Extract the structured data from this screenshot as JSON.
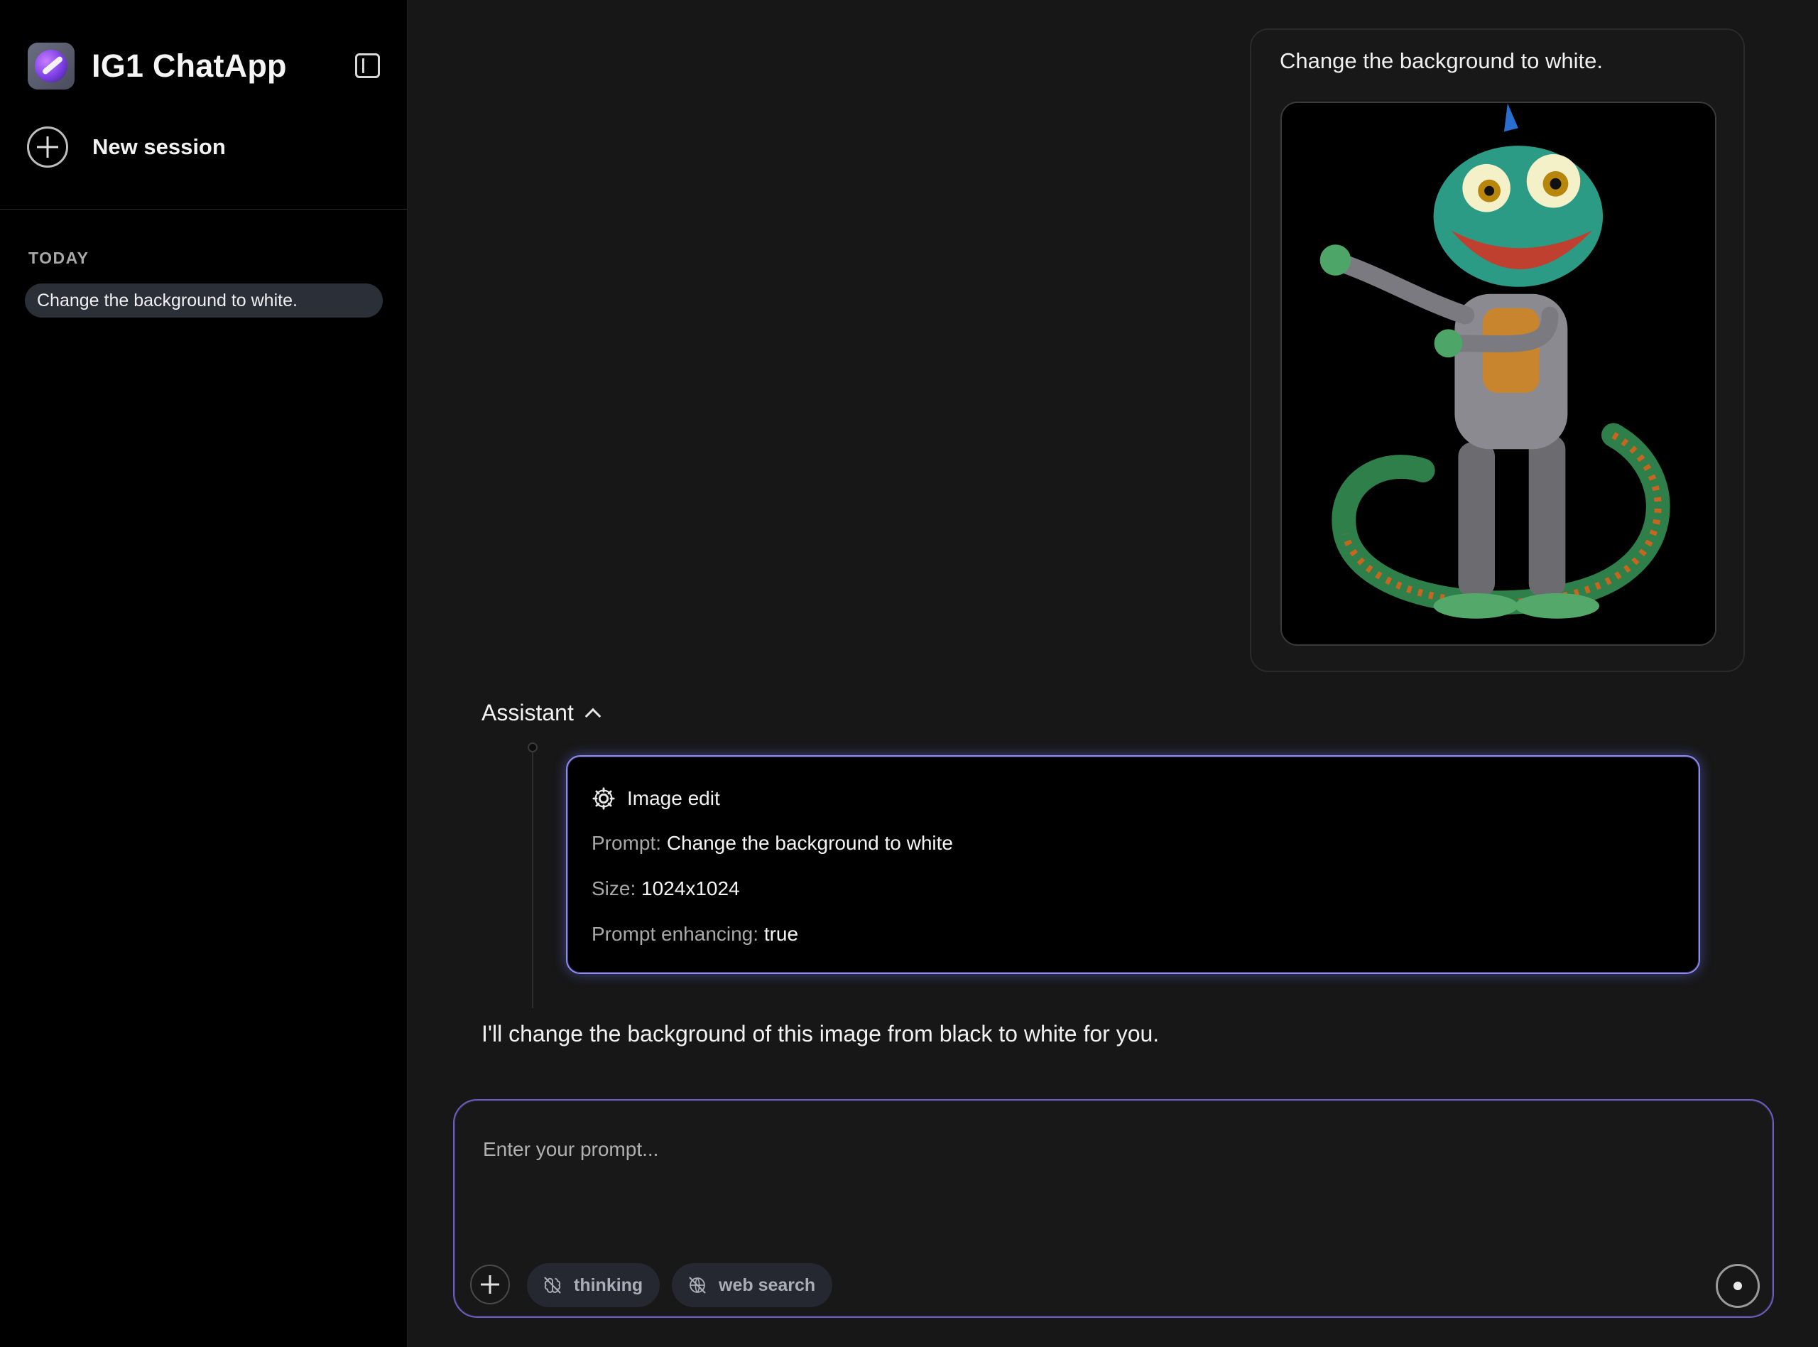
{
  "app": {
    "title": "IG1 ChatApp"
  },
  "sidebar": {
    "new_session_label": "New session",
    "sections": [
      {
        "label": "TODAY",
        "items": [
          {
            "label": "Change the background to white.",
            "active": true
          }
        ]
      }
    ]
  },
  "chat": {
    "user_message": {
      "text": "Change the background to white.",
      "attachment_icon": "robot-chameleon-image"
    },
    "assistant": {
      "name": "Assistant",
      "tool_call": {
        "title": "Image edit",
        "icon": "gear-icon",
        "params": [
          {
            "label": "Prompt:",
            "value": "Change the background to white"
          },
          {
            "label": "Size:",
            "value": "1024x1024"
          },
          {
            "label": "Prompt enhancing:",
            "value": "true"
          }
        ]
      },
      "text": "I'll change the background of this image from black to white for you."
    }
  },
  "composer": {
    "placeholder": "Enter your prompt...",
    "chips": [
      {
        "label": "thinking",
        "icon": "brain-off-icon"
      },
      {
        "label": "web search",
        "icon": "globe-off-icon"
      }
    ]
  },
  "colors": {
    "accent_border": "#8a8cf2",
    "composer_border": "#6e5dbf",
    "sidebar_bg": "#000000",
    "main_bg": "#171717"
  }
}
